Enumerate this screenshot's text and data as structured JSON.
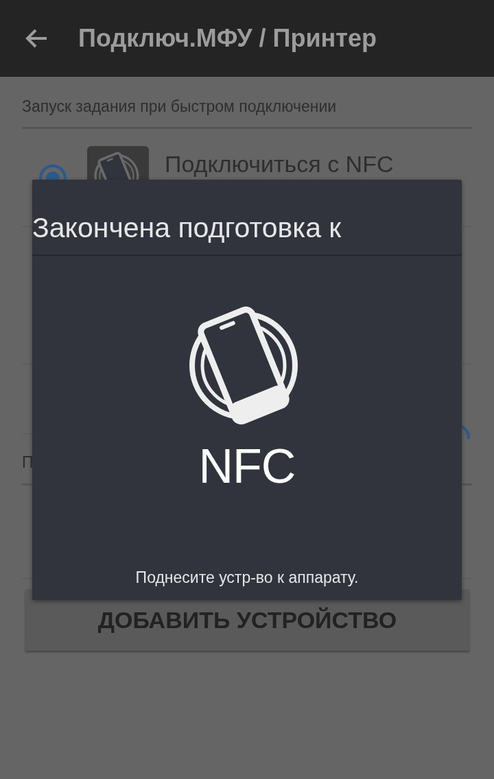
{
  "app_bar": {
    "title": "Подключ.МФУ / Принтер"
  },
  "sections": [
    {
      "header": "Запуск задания при быстром подключении",
      "options": [
        {
          "label": "Подключиться с NFC",
          "selected": true
        }
      ]
    },
    {
      "header": "П"
    }
  ],
  "button": "ДОБАВИТЬ УСТРОЙСТВО",
  "dialog": {
    "title": "Закончена подготовка к",
    "logo_text": "NFC",
    "message": "Поднесите устр-во к аппарату."
  }
}
